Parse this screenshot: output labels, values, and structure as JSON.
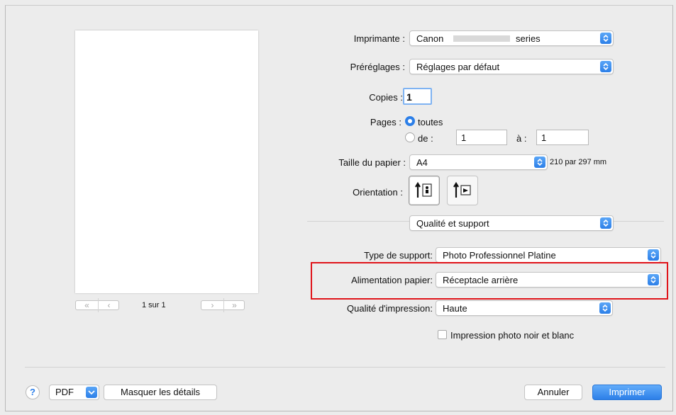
{
  "printer": {
    "label": "Imprimante :",
    "value": "Canon",
    "value_suffix": "series"
  },
  "presets": {
    "label": "Préréglages :",
    "value": "Réglages par défaut"
  },
  "copies": {
    "label": "Copies :",
    "value": "1"
  },
  "pages": {
    "label": "Pages :",
    "all_label": "toutes",
    "from_label": "de :",
    "from_value": "1",
    "to_label": "à :",
    "to_value": "1",
    "selected": "all"
  },
  "paper_size": {
    "label": "Taille du papier :",
    "value": "A4",
    "dimensions": "210 par 297 mm"
  },
  "orientation": {
    "label": "Orientation :",
    "selected": "portrait"
  },
  "section_menu": {
    "value": "Qualité et support"
  },
  "media_type": {
    "label": "Type de support:",
    "value": "Photo Professionnel Platine"
  },
  "paper_source": {
    "label": "Alimentation papier:",
    "value": "Réceptacle arrière",
    "highlight_color": "#e0141a"
  },
  "print_quality": {
    "label": "Qualité d'impression:",
    "value": "Haute"
  },
  "bw_photo": {
    "label": "Impression photo noir et blanc",
    "checked": false
  },
  "preview": {
    "page_indicator": "1 sur 1",
    "first_icon": "«",
    "prev_icon": "‹",
    "next_icon": "›",
    "last_icon": "»"
  },
  "footer": {
    "help_icon": "?",
    "pdf_label": "PDF",
    "hide_details_label": "Masquer les détails",
    "cancel_label": "Annuler",
    "print_label": "Imprimer"
  },
  "colors": {
    "accent": "#2c7fe8"
  }
}
